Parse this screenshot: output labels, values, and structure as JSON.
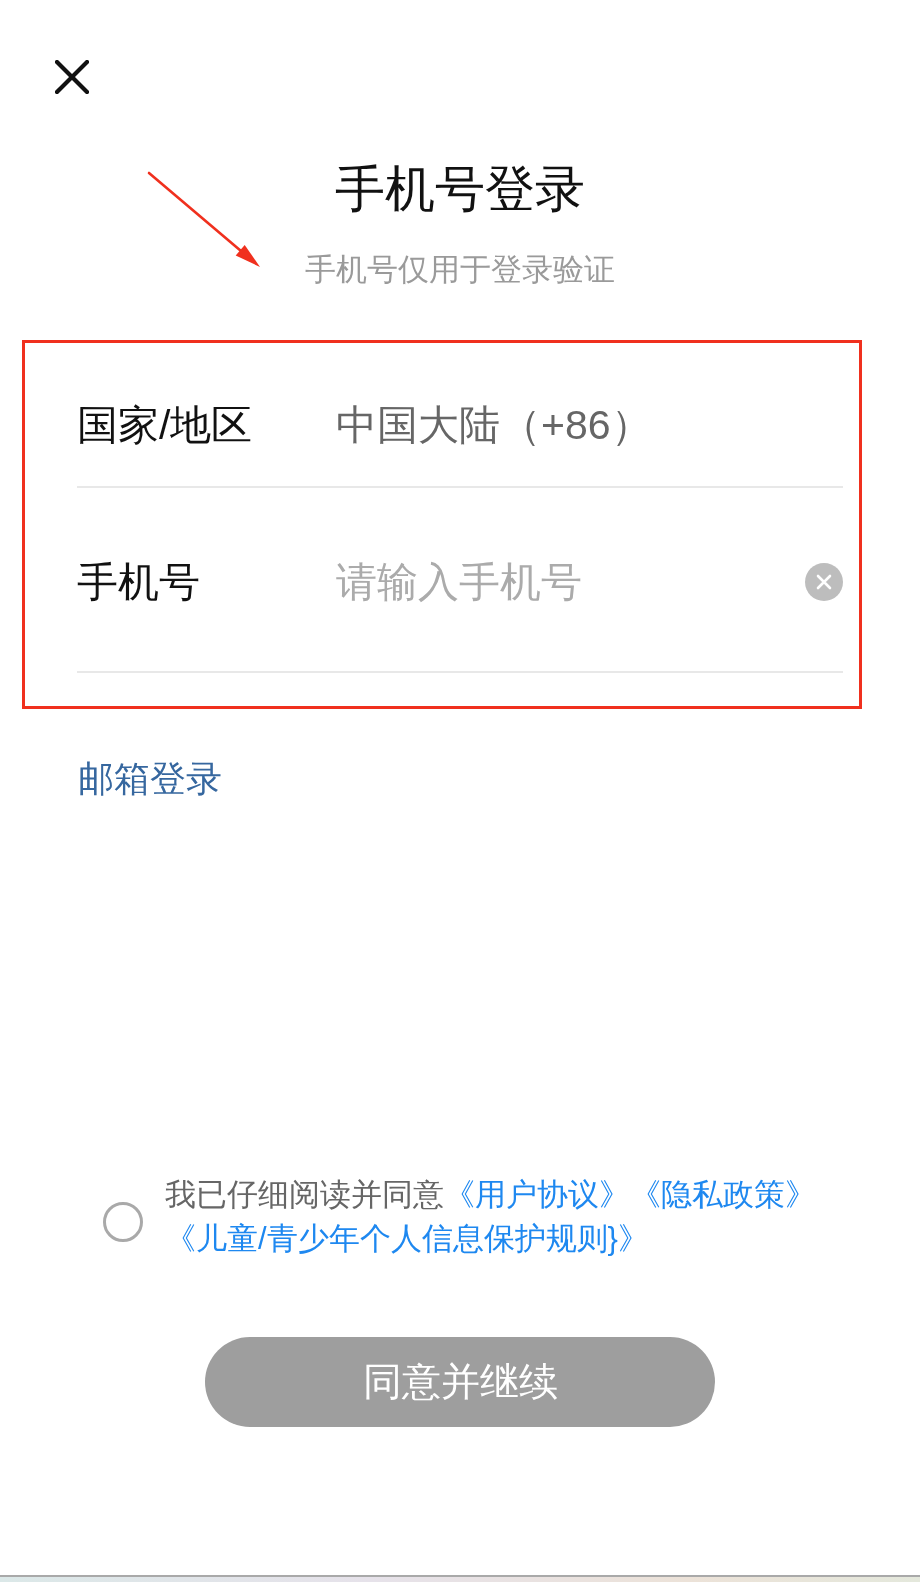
{
  "title": "手机号登录",
  "subtitle": "手机号仅用于登录验证",
  "annotations": [
    {
      "kind": "arrow"
    }
  ],
  "form": {
    "highlighted": true,
    "rows": [
      {
        "kind": "select",
        "label": "国家/地区",
        "value": "中国大陆（+86）"
      },
      {
        "kind": "input",
        "label": "手机号",
        "placeholder": "请输入手机号"
      }
    ]
  },
  "email_login_link": "邮箱登录",
  "agreement": {
    "checked": false,
    "text": "我已仔细阅读并同意",
    "links": [
      "《用户协议》",
      "《隐私政策》",
      "《儿童/青少年个人信息保护规则}》"
    ]
  },
  "submit_button": {
    "label": "同意并继续",
    "disabled": true
  }
}
